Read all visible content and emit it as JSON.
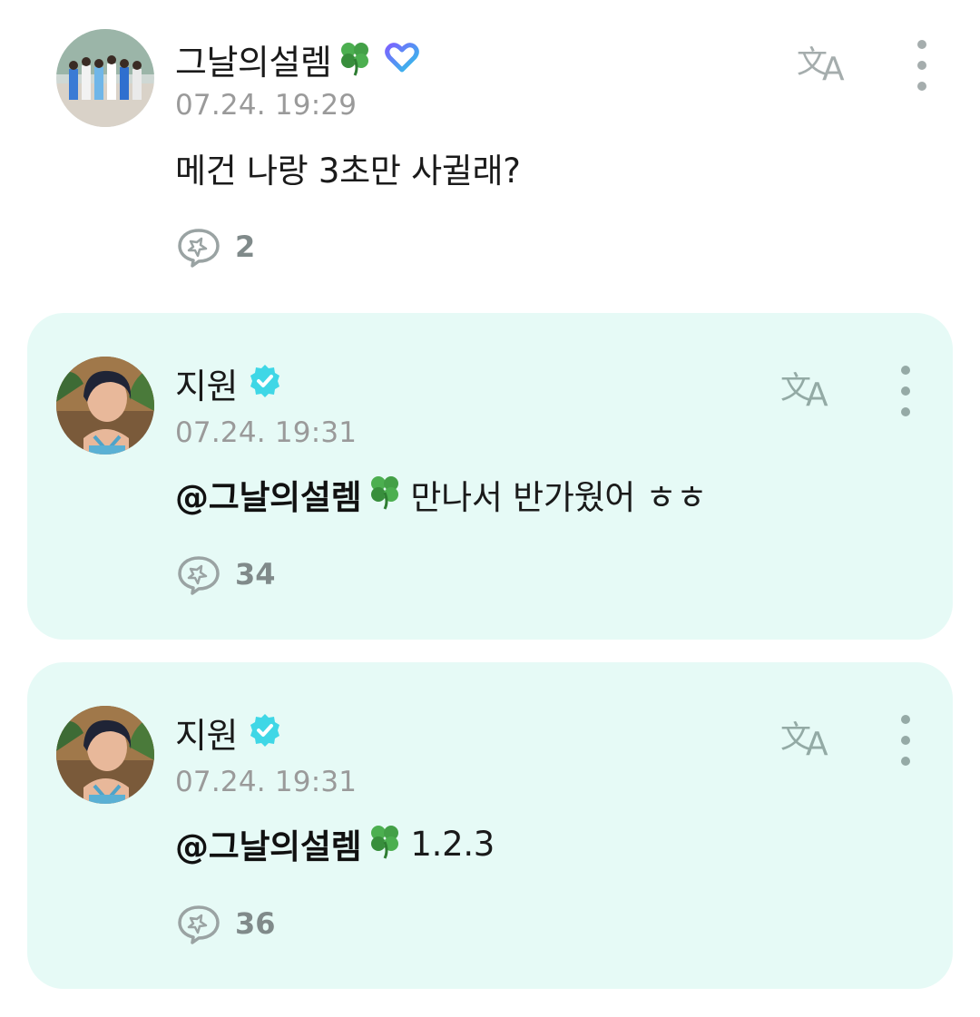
{
  "comments": [
    {
      "author": "그날의설렘",
      "time": "07.24. 19:29",
      "text": "메건 나랑 3초만 사귈래?",
      "reply_count": "2"
    },
    {
      "author": "지원",
      "time": "07.24. 19:31",
      "mention": "@그날의설렘",
      "text": "만나서 반가웠어 ㅎㅎ",
      "reply_count": "34"
    },
    {
      "author": "지원",
      "time": "07.24. 19:31",
      "mention": "@그날의설렘",
      "text": "1.2.3",
      "reply_count": "36"
    }
  ],
  "icons": {
    "translate": "translate-icon",
    "more": "more-vertical-icon",
    "reply": "reply-bubble-icon",
    "verified": "verified-badge-icon",
    "fan_badge": "heart-badge-icon",
    "clover": "four-leaf-clover-icon"
  },
  "colors": {
    "artist_card_bg": "#e6faf6",
    "verified": "#3fd7e6",
    "timestamp": "#9a9a9a",
    "icon_gray": "#a5adad"
  }
}
